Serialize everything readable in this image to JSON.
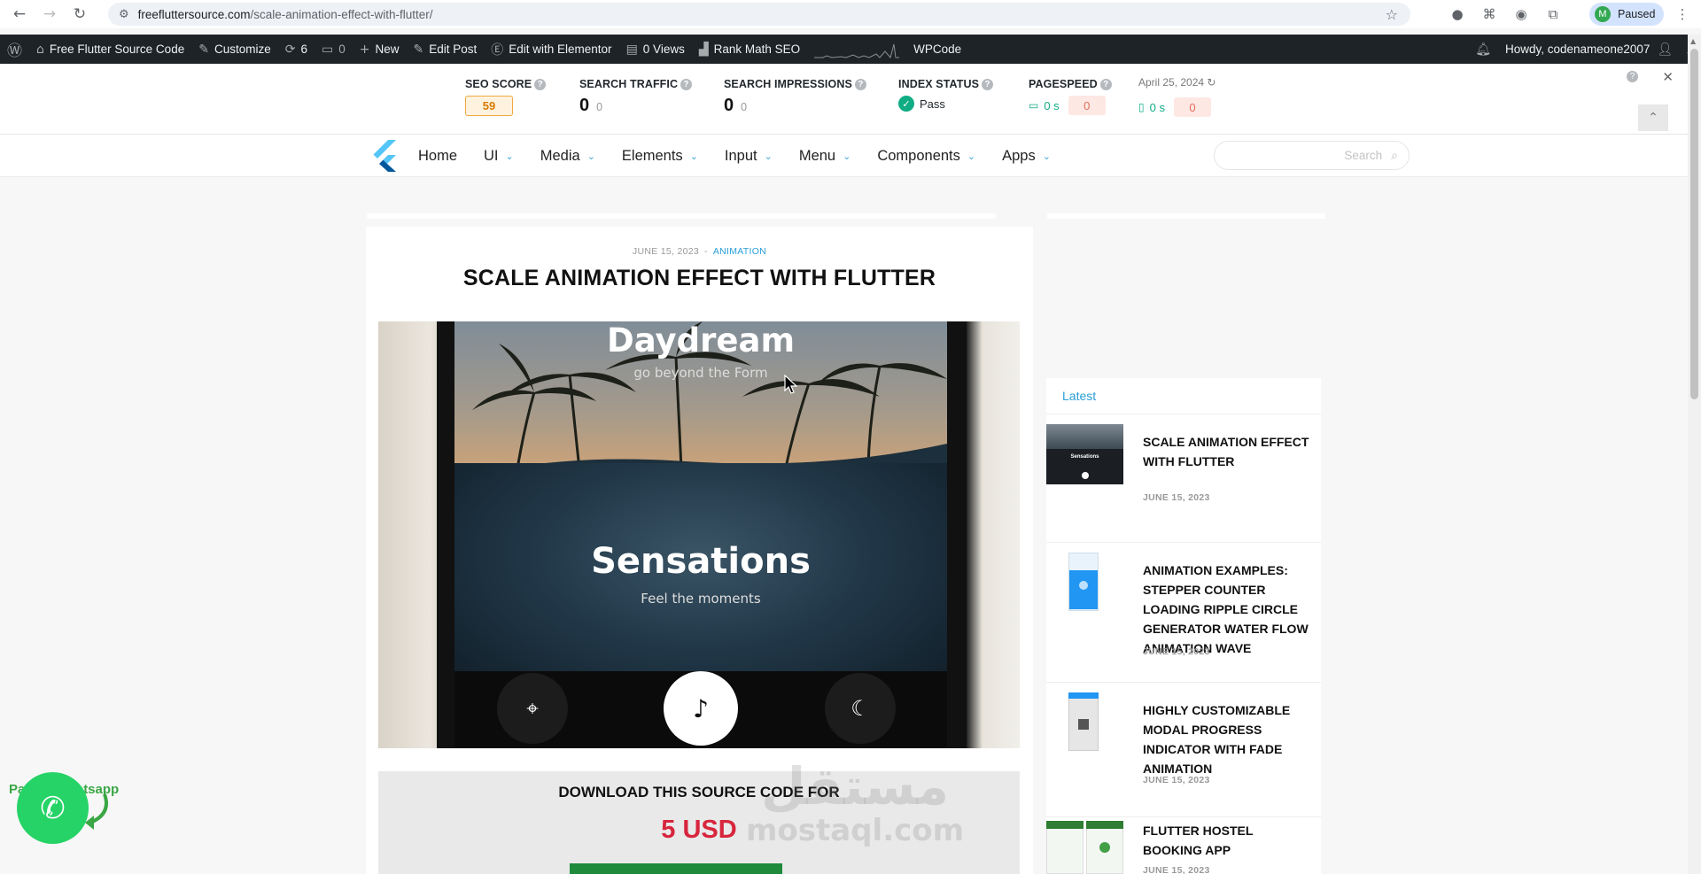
{
  "browser": {
    "url_domain": "freefluttersource.com",
    "url_path": "/scale-animation-effect-with-flutter/",
    "profile_initial": "M",
    "profile_status": "Paused",
    "back_icon": "arrow-back-icon",
    "forward_icon": "arrow-forward-icon",
    "reload_icon": "reload-icon",
    "star_icon": "bookmark-star-icon"
  },
  "adminbar": {
    "site_name": "Free Flutter Source Code",
    "customize": "Customize",
    "updates_count": "6",
    "comments_count": "0",
    "new_label": "New",
    "edit_post": "Edit Post",
    "edit_elementor": "Edit with Elementor",
    "views": "0 Views",
    "rank_math": "Rank Math SEO",
    "wpcode": "WPCode",
    "howdy": "Howdy, codenameone2007"
  },
  "rankmath": {
    "seo_score_label": "SEO SCORE",
    "seo_score": "59",
    "traffic_label": "SEARCH TRAFFIC",
    "traffic_value": "0",
    "traffic_change": "0",
    "impressions_label": "SEARCH IMPRESSIONS",
    "impressions_value": "0",
    "impressions_change": "0",
    "index_label": "INDEX STATUS",
    "index_value": "Pass",
    "pagespeed_label": "PAGESPEED",
    "pagespeed_date": "April 25, 2024",
    "desktop_time": "0 s",
    "desktop_score": "0",
    "mobile_time": "0 s",
    "mobile_score": "0"
  },
  "nav": {
    "items": [
      {
        "label": "Home",
        "dropdown": false
      },
      {
        "label": "UI",
        "dropdown": true
      },
      {
        "label": "Media",
        "dropdown": true
      },
      {
        "label": "Elements",
        "dropdown": true
      },
      {
        "label": "Input",
        "dropdown": true
      },
      {
        "label": "Menu",
        "dropdown": true
      },
      {
        "label": "Components",
        "dropdown": true
      },
      {
        "label": "Apps",
        "dropdown": true
      }
    ],
    "search_placeholder": "Search"
  },
  "article": {
    "date": "JUNE 15, 2023",
    "separator": "-",
    "category": "ANIMATION",
    "title": "SCALE ANIMATION EFFECT WITH FLUTTER",
    "hero": {
      "title_top": "Daydream",
      "sub_top": "go beyond the Form",
      "title_bottom": "Sensations",
      "sub_bottom": "Feel the moments"
    },
    "download_title": "DOWNLOAD THIS SOURCE CODE FOR",
    "price": "5 USD"
  },
  "watermark": {
    "arabic": "مستقل",
    "latin": "mostaql.com"
  },
  "sidebar": {
    "heading": "Latest",
    "posts": [
      {
        "title": "SCALE ANIMATION EFFECT WITH FLUTTER",
        "date": "JUNE 15, 2023",
        "thumb_label": "Sensations"
      },
      {
        "title": "ANIMATION EXAMPLES: STEPPER COUNTER LOADING RIPPLE CIRCLE GENERATOR WATER FLOW ANIMATION WAVE",
        "date": "JUNE 15, 2023"
      },
      {
        "title": "HIGHLY CUSTOMIZABLE MODAL PROGRESS INDICATOR WITH FADE ANIMATION",
        "date": "JUNE 15, 2023"
      },
      {
        "title": "FLUTTER HOSTEL BOOKING APP",
        "date": "JUNE 15, 2023"
      }
    ]
  },
  "whatsapp": {
    "label": "Pay by Whatsapp"
  }
}
